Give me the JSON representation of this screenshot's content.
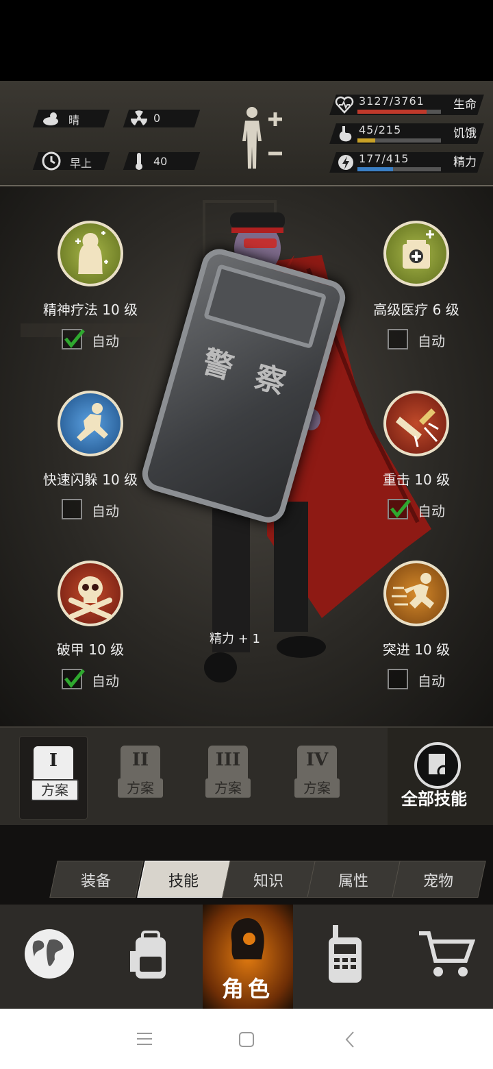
{
  "status": {
    "weather": "晴",
    "radiation": "0",
    "time_of_day": "早上",
    "temperature": "40",
    "health": {
      "label": "生命",
      "text": "3127/3761",
      "fraction": 0.8314,
      "color": "#c0392b"
    },
    "hunger": {
      "label": "饥饿",
      "text": "45/215",
      "fraction": 0.2093,
      "color": "#c9a227"
    },
    "energy": {
      "label": "精力",
      "text": "177/415",
      "fraction": 0.4265,
      "color": "#3b7fc4"
    }
  },
  "skills": [
    {
      "id": "mental-therapy",
      "label": "精神疗法 10 级",
      "auto_label": "自动",
      "auto": true,
      "icon": "meditation-icon",
      "color": "#7b8a2a"
    },
    {
      "id": "advanced-medical",
      "label": "高级医疗 6 级",
      "auto_label": "自动",
      "auto": false,
      "icon": "medkit-icon",
      "color": "#7b8a2a"
    },
    {
      "id": "quick-dodge",
      "label": "快速闪躲 10 级",
      "auto_label": "自动",
      "auto": false,
      "icon": "dodge-icon",
      "color": "#2a6aa8"
    },
    {
      "id": "heavy-strike",
      "label": "重击 10 级",
      "auto_label": "自动",
      "auto": true,
      "icon": "hammer-strike-icon",
      "color": "#8a2a1c"
    },
    {
      "id": "armor-break",
      "label": "破甲 10 级",
      "auto_label": "自动",
      "auto": true,
      "icon": "skull-crossbones-icon",
      "color": "#8a2a1c"
    },
    {
      "id": "charge",
      "label": "突进 10 级",
      "auto_label": "自动",
      "auto": false,
      "icon": "sprint-icon",
      "color": "#a86a1c"
    }
  ],
  "character": {
    "shield_text": "警 察",
    "buff_text": "精力 + 1"
  },
  "plans": [
    {
      "roman": "I",
      "label": "方案",
      "active": true
    },
    {
      "roman": "II",
      "label": "方案",
      "active": false
    },
    {
      "roman": "III",
      "label": "方案",
      "active": false
    },
    {
      "roman": "IV",
      "label": "方案",
      "active": false
    }
  ],
  "all_skills_label": "全部技能",
  "tabs": [
    {
      "label": "装备",
      "active": false
    },
    {
      "label": "技能",
      "active": true
    },
    {
      "label": "知识",
      "active": false
    },
    {
      "label": "属性",
      "active": false
    },
    {
      "label": "宠物",
      "active": false
    }
  ],
  "nav": {
    "character_label": "角色",
    "items": [
      "globe-icon",
      "backpack-icon",
      "character-icon",
      "walkie-talkie-icon",
      "shopping-cart-icon"
    ]
  }
}
